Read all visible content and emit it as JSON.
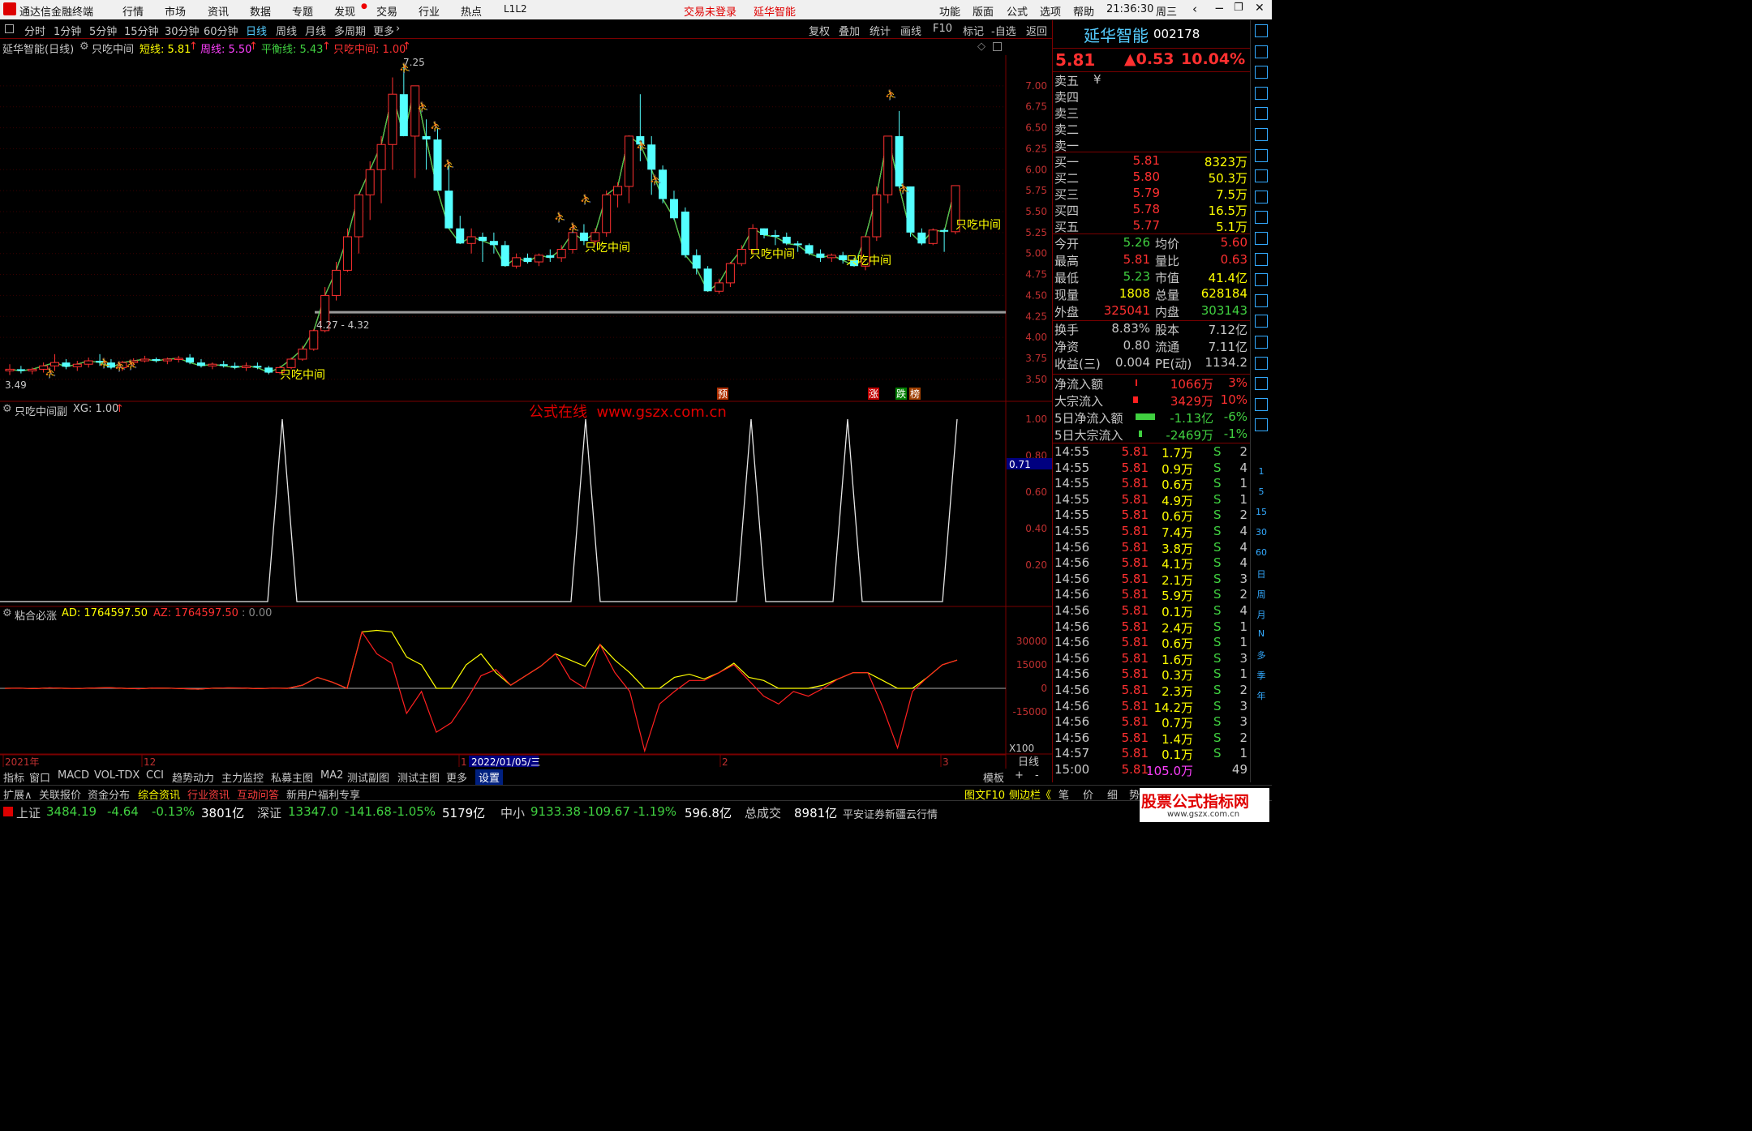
{
  "titlebar": {
    "app_name": "通达信金融终端",
    "menu": [
      "行情",
      "市场",
      "资讯",
      "数据",
      "专题",
      "发现",
      "交易",
      "行业",
      "热点",
      "L1L2"
    ],
    "trade_status": "交易未登录",
    "stock_name": "延华智能",
    "right_menu": [
      "功能",
      "版面",
      "公式",
      "选项",
      "帮助"
    ],
    "time": "21:36:30",
    "weekday": "周三"
  },
  "periodbar": {
    "periods": [
      "分时",
      "1分钟",
      "5分钟",
      "15分钟",
      "30分钟",
      "60分钟",
      "日线",
      "周线",
      "月线",
      "多周期",
      "更多"
    ],
    "active": "日线",
    "right_buttons": [
      "复权",
      "叠加",
      "统计",
      "画线",
      "F10",
      "标记",
      "-自选",
      "返回"
    ]
  },
  "main_chart": {
    "title": "延华智能(日线)",
    "indicator": "只吃中间",
    "lines": [
      {
        "label": "短线: 5.81",
        "color": "#ffff00"
      },
      {
        "label": "周线: 5.50",
        "color": "#ff40ff"
      },
      {
        "label": "平衡线: 5.43",
        "color": "#40d040"
      },
      {
        "label": "只吃中间: 1.00",
        "color": "#ff3030"
      }
    ],
    "high_label": "7.25",
    "low_label": "3.49",
    "range_label": "4.27 - 4.32",
    "signal_text": "只吃中间",
    "markers": [
      "预",
      "涨",
      "跌",
      "榜"
    ],
    "y_ticks": [
      "7.00",
      "6.75",
      "6.50",
      "6.25",
      "6.00",
      "5.75",
      "5.50",
      "5.25",
      "5.00",
      "4.75",
      "4.50",
      "4.25",
      "4.00",
      "3.75",
      "3.50"
    ],
    "watermark": "公式在线  www.gszx.com.cn"
  },
  "sub1": {
    "title": "只吃中间副",
    "value_label": "XG: 1.00",
    "y_ticks": [
      "1.00",
      "0.80",
      "0.60",
      "0.40",
      "0.20"
    ],
    "cursor_value": "0.71"
  },
  "sub2": {
    "title": "粘合必涨",
    "ad_label": "AD: 1764597.50",
    "az_label": "AZ: 1764597.50",
    "zero_label": ": 0.00",
    "y_ticks": [
      "30000",
      "15000",
      "0",
      "-15000"
    ],
    "scale_label": "X100"
  },
  "xaxis": {
    "labels": [
      "2021年",
      "12",
      "1",
      "2022/01/05/三",
      "2",
      "3"
    ],
    "period": "日线"
  },
  "chart_data": [
    {
      "type": "candlestick",
      "title": "延华智能(日线)",
      "candles": [
        [
          3.6,
          3.68,
          3.55,
          3.62
        ],
        [
          3.62,
          3.66,
          3.57,
          3.6
        ],
        [
          3.6,
          3.64,
          3.56,
          3.62
        ],
        [
          3.62,
          3.7,
          3.58,
          3.66
        ],
        [
          3.66,
          3.8,
          3.6,
          3.7
        ],
        [
          3.7,
          3.74,
          3.62,
          3.65
        ],
        [
          3.65,
          3.72,
          3.6,
          3.68
        ],
        [
          3.68,
          3.76,
          3.64,
          3.72
        ],
        [
          3.72,
          3.8,
          3.66,
          3.7
        ],
        [
          3.7,
          3.74,
          3.62,
          3.64
        ],
        [
          3.64,
          3.72,
          3.6,
          3.7
        ],
        [
          3.7,
          3.75,
          3.66,
          3.72
        ],
        [
          3.72,
          3.78,
          3.7,
          3.74
        ],
        [
          3.74,
          3.76,
          3.7,
          3.72
        ],
        [
          3.72,
          3.76,
          3.68,
          3.74
        ],
        [
          3.74,
          3.78,
          3.7,
          3.75
        ],
        [
          3.76,
          3.8,
          3.68,
          3.7
        ],
        [
          3.7,
          3.74,
          3.64,
          3.66
        ],
        [
          3.66,
          3.7,
          3.62,
          3.68
        ],
        [
          3.68,
          3.72,
          3.64,
          3.66
        ],
        [
          3.66,
          3.7,
          3.62,
          3.64
        ],
        [
          3.64,
          3.7,
          3.6,
          3.66
        ],
        [
          3.66,
          3.7,
          3.62,
          3.64
        ],
        [
          3.64,
          3.66,
          3.56,
          3.58
        ],
        [
          3.58,
          3.66,
          3.56,
          3.64
        ],
        [
          3.64,
          3.76,
          3.62,
          3.74
        ],
        [
          3.74,
          3.9,
          3.72,
          3.86
        ],
        [
          3.86,
          4.1,
          3.84,
          4.08
        ],
        [
          4.08,
          4.6,
          4.06,
          4.5
        ],
        [
          4.5,
          4.9,
          4.44,
          4.8
        ],
        [
          4.8,
          5.3,
          4.78,
          5.2
        ],
        [
          5.2,
          5.7,
          5.0,
          5.7
        ],
        [
          5.7,
          6.1,
          5.4,
          6.0
        ],
        [
          6.0,
          6.4,
          5.6,
          6.3
        ],
        [
          6.3,
          7.1,
          6.0,
          6.9
        ],
        [
          6.9,
          7.25,
          6.4,
          6.4
        ],
        [
          6.4,
          7.0,
          5.9,
          7.0
        ],
        [
          6.4,
          6.6,
          6.0,
          6.36
        ],
        [
          6.36,
          6.5,
          5.8,
          5.75
        ],
        [
          5.75,
          6.05,
          5.3,
          5.3
        ],
        [
          5.3,
          5.45,
          5.12,
          5.12
        ],
        [
          5.12,
          5.3,
          5.0,
          5.2
        ],
        [
          5.2,
          5.25,
          4.9,
          5.15
        ],
        [
          5.15,
          5.25,
          5.0,
          5.1
        ],
        [
          5.1,
          5.15,
          4.85,
          4.85
        ],
        [
          4.85,
          5.0,
          4.82,
          4.95
        ],
        [
          4.95,
          5.0,
          4.88,
          4.9
        ],
        [
          4.9,
          5.0,
          4.85,
          4.98
        ],
        [
          4.98,
          5.05,
          4.9,
          4.95
        ],
        [
          4.95,
          5.1,
          4.9,
          5.05
        ],
        [
          5.05,
          5.35,
          5.0,
          5.25
        ],
        [
          5.25,
          5.35,
          5.1,
          5.15
        ],
        [
          5.15,
          5.3,
          5.1,
          5.25
        ],
        [
          5.25,
          5.75,
          5.2,
          5.7
        ],
        [
          5.7,
          5.85,
          5.55,
          5.8
        ],
        [
          5.8,
          6.4,
          5.6,
          6.4
        ],
        [
          6.4,
          6.9,
          6.1,
          6.3
        ],
        [
          6.3,
          6.4,
          5.7,
          6.0
        ],
        [
          6.0,
          6.05,
          5.6,
          5.65
        ],
        [
          5.65,
          5.75,
          5.4,
          5.42
        ],
        [
          5.5,
          5.55,
          4.95,
          4.98
        ],
        [
          4.98,
          5.05,
          4.75,
          4.82
        ],
        [
          4.82,
          4.85,
          4.55,
          4.55
        ],
        [
          4.55,
          4.7,
          4.52,
          4.65
        ],
        [
          4.65,
          4.9,
          4.6,
          4.88
        ],
        [
          4.88,
          5.1,
          4.85,
          5.05
        ],
        [
          5.05,
          5.35,
          5.0,
          5.3
        ],
        [
          5.3,
          5.3,
          5.18,
          5.22
        ],
        [
          5.22,
          5.28,
          5.1,
          5.2
        ],
        [
          5.2,
          5.25,
          5.1,
          5.12
        ],
        [
          5.12,
          5.15,
          5.02,
          5.1
        ],
        [
          5.1,
          5.12,
          4.98,
          5.0
        ],
        [
          5.0,
          5.05,
          4.9,
          4.95
        ],
        [
          4.95,
          5.0,
          4.9,
          4.98
        ],
        [
          4.98,
          5.02,
          4.88,
          4.92
        ],
        [
          4.92,
          4.95,
          4.85,
          4.85
        ],
        [
          4.85,
          5.2,
          4.8,
          5.2
        ],
        [
          5.2,
          5.8,
          5.15,
          5.7
        ],
        [
          5.7,
          6.4,
          5.6,
          6.4
        ],
        [
          6.4,
          6.7,
          5.78,
          5.8
        ],
        [
          5.8,
          5.8,
          5.2,
          5.25
        ],
        [
          5.25,
          5.3,
          5.1,
          5.12
        ],
        [
          5.12,
          5.3,
          5.1,
          5.28
        ],
        [
          5.28,
          5.3,
          5.02,
          5.26
        ],
        [
          5.26,
          5.81,
          5.23,
          5.81
        ]
      ],
      "series": [
        {
          "name": "短线",
          "value": 5.81
        },
        {
          "name": "周线",
          "value": 5.5
        },
        {
          "name": "平衡线",
          "value": 5.43
        }
      ],
      "ylim": [
        3.45,
        7.25
      ],
      "high": 7.25,
      "low": 3.49
    },
    {
      "type": "line",
      "title": "只吃中间副",
      "series": [
        {
          "name": "XG",
          "values": [
            0,
            0,
            0,
            0,
            0,
            0,
            0,
            0,
            0,
            0,
            0,
            0,
            0,
            0,
            0,
            0,
            0,
            0,
            0,
            0,
            0,
            0,
            0,
            0,
            0,
            0,
            0,
            0,
            0,
            0,
            0,
            0,
            0,
            0,
            0,
            0,
            0,
            0,
            0,
            0,
            0,
            0,
            0,
            0,
            0,
            0,
            0,
            0,
            0,
            0,
            0,
            0,
            0,
            1,
            0,
            0,
            0,
            0,
            0,
            0,
            0,
            0,
            0,
            0,
            0,
            0,
            0,
            0,
            0,
            0,
            0,
            0,
            0,
            0,
            0,
            0,
            0,
            0,
            0,
            0,
            0,
            0,
            0,
            0,
            1
          ]
        }
      ],
      "spikes_at": [
        20,
        53,
        67,
        77,
        84
      ],
      "ylim": [
        0,
        1
      ]
    },
    {
      "type": "line",
      "title": "粘合必涨",
      "series": [
        {
          "name": "AD",
          "values": [
            0,
            100,
            -200,
            300,
            0,
            -100,
            200,
            400,
            0,
            -300,
            200,
            100,
            -200,
            -500,
            100,
            300,
            200,
            -200,
            100,
            0,
            2000,
            7000,
            4000,
            0,
            36000,
            37000,
            36000,
            20000,
            15000,
            0,
            0,
            15000,
            22000,
            10000,
            2000,
            8000,
            14000,
            22000,
            18000,
            14000,
            28000,
            18000,
            10000,
            0,
            0,
            7000,
            9000,
            6000,
            10000,
            16000,
            7000,
            5000,
            0,
            0,
            0,
            2000,
            6000,
            10000,
            10000,
            5000,
            0,
            0,
            7000,
            15000,
            18000
          ]
        },
        {
          "name": "AZ",
          "values": [
            0,
            100,
            -200,
            300,
            0,
            -100,
            200,
            400,
            0,
            -300,
            200,
            100,
            -200,
            -500,
            100,
            300,
            200,
            -200,
            100,
            0,
            2000,
            7000,
            4000,
            0,
            36000,
            22000,
            16000,
            -16000,
            -2000,
            -28000,
            -22000,
            -8000,
            8000,
            12000,
            2000,
            8000,
            14000,
            22000,
            6000,
            0,
            28000,
            10000,
            -2000,
            -40000,
            -10000,
            -2000,
            5000,
            5000,
            10000,
            15000,
            5000,
            -5000,
            -10000,
            -2000,
            -5000,
            0,
            6000,
            10000,
            10000,
            -12000,
            -38000,
            -2000,
            7000,
            15000,
            18000
          ]
        }
      ],
      "ylim": [
        -40000,
        40000
      ]
    }
  ],
  "quote": {
    "name": "延华智能",
    "code": "002178",
    "price": "5.81",
    "change": "▲0.53",
    "pct": "10.04%",
    "sells": [
      {
        "label": "卖五",
        "price": "",
        "vol": "",
        "extra": "¥"
      },
      {
        "label": "卖四",
        "price": "",
        "vol": ""
      },
      {
        "label": "卖三",
        "price": "",
        "vol": ""
      },
      {
        "label": "卖二",
        "price": "",
        "vol": ""
      },
      {
        "label": "卖一",
        "price": "",
        "vol": ""
      }
    ],
    "buys": [
      {
        "label": "买一",
        "price": "5.81",
        "vol": "8323万"
      },
      {
        "label": "买二",
        "price": "5.80",
        "vol": "50.3万"
      },
      {
        "label": "买三",
        "price": "5.79",
        "vol": "7.5万"
      },
      {
        "label": "买四",
        "price": "5.78",
        "vol": "16.5万"
      },
      {
        "label": "买五",
        "price": "5.77",
        "vol": "5.1万"
      }
    ],
    "stats": [
      [
        "今开",
        "5.26",
        "均价",
        "5.60"
      ],
      [
        "最高",
        "5.81",
        "量比",
        "0.63"
      ],
      [
        "最低",
        "5.23",
        "市值",
        "41.4亿"
      ],
      [
        "现量",
        "1808",
        "总量",
        "628184"
      ],
      [
        "外盘",
        "325041",
        "内盘",
        "303143"
      ]
    ],
    "stats2": [
      [
        "换手",
        "8.83%",
        "股本",
        "7.12亿"
      ],
      [
        "净资",
        "0.80",
        "流通",
        "7.11亿"
      ],
      [
        "收益(三)",
        "0.004",
        "PE(动)",
        "1134.2"
      ]
    ],
    "flows": [
      [
        "净流入额",
        "1066万",
        "3%"
      ],
      [
        "大宗流入",
        "3429万",
        "10%"
      ],
      [
        "5日净流入额",
        "-1.13亿",
        "-6%"
      ],
      [
        "5日大宗流入",
        "-2469万",
        "-1%"
      ]
    ]
  },
  "ticks": [
    [
      "14:55",
      "5.81",
      "1.7万",
      "S",
      "2"
    ],
    [
      "14:55",
      "5.81",
      "0.9万",
      "S",
      "4"
    ],
    [
      "14:55",
      "5.81",
      "0.6万",
      "S",
      "1"
    ],
    [
      "14:55",
      "5.81",
      "4.9万",
      "S",
      "1"
    ],
    [
      "14:55",
      "5.81",
      "0.6万",
      "S",
      "2"
    ],
    [
      "14:55",
      "5.81",
      "7.4万",
      "S",
      "4"
    ],
    [
      "14:56",
      "5.81",
      "3.8万",
      "S",
      "4"
    ],
    [
      "14:56",
      "5.81",
      "4.1万",
      "S",
      "4"
    ],
    [
      "14:56",
      "5.81",
      "2.1万",
      "S",
      "3"
    ],
    [
      "14:56",
      "5.81",
      "5.9万",
      "S",
      "2"
    ],
    [
      "14:56",
      "5.81",
      "0.1万",
      "S",
      "4"
    ],
    [
      "14:56",
      "5.81",
      "2.4万",
      "S",
      "1"
    ],
    [
      "14:56",
      "5.81",
      "0.6万",
      "S",
      "1"
    ],
    [
      "14:56",
      "5.81",
      "1.6万",
      "S",
      "3"
    ],
    [
      "14:56",
      "5.81",
      "0.3万",
      "S",
      "1"
    ],
    [
      "14:56",
      "5.81",
      "2.3万",
      "S",
      "2"
    ],
    [
      "14:56",
      "5.81",
      "14.2万",
      "S",
      "3"
    ],
    [
      "14:56",
      "5.81",
      "0.7万",
      "S",
      "3"
    ],
    [
      "14:56",
      "5.81",
      "1.4万",
      "S",
      "2"
    ],
    [
      "14:57",
      "5.81",
      "0.1万",
      "S",
      "1"
    ],
    [
      "15:00",
      "5.81",
      "105.0万",
      "",
      "49"
    ]
  ],
  "toolstrip": [
    "1",
    "5",
    "15",
    "30",
    "60",
    "日",
    "周",
    "月",
    "N",
    "多",
    "季",
    "年"
  ],
  "bottomtabs": [
    "指标",
    "窗口",
    "MACD",
    "VOL-TDX",
    "CCI",
    "趋势动力",
    "主力监控",
    "私募主图",
    "MA2",
    "测试副图",
    "测试主图",
    "更多",
    "设置",
    "模板",
    "+",
    "-"
  ],
  "extbar": [
    "扩展∧",
    "关联报价",
    "资金分布",
    "综合资讯",
    "行业资讯",
    "互动问答",
    "新用户福利专享"
  ],
  "extbar_right": [
    "图文F10",
    "侧边栏《",
    "笔",
    "价",
    "细",
    "势"
  ],
  "statusbar": {
    "sh": {
      "name": "上证",
      "value": "3484.19",
      "chg": "-4.64",
      "pct": "-0.13%",
      "amt": "3801亿"
    },
    "sz": {
      "name": "深证",
      "value": "13347.0",
      "chg": "-141.68",
      "pct": "-1.05%",
      "amt": "5179亿"
    },
    "zx": {
      "name": "中小",
      "value": "9133.38",
      "chg": "-109.67",
      "pct": "-1.19%",
      "amt": "596.8亿"
    },
    "total_label": "总成交",
    "total": "8981亿",
    "broker": "平安证券新疆云行情",
    "logo": "股票公式指标网",
    "logo_url": "www.gszx.com.cn"
  }
}
